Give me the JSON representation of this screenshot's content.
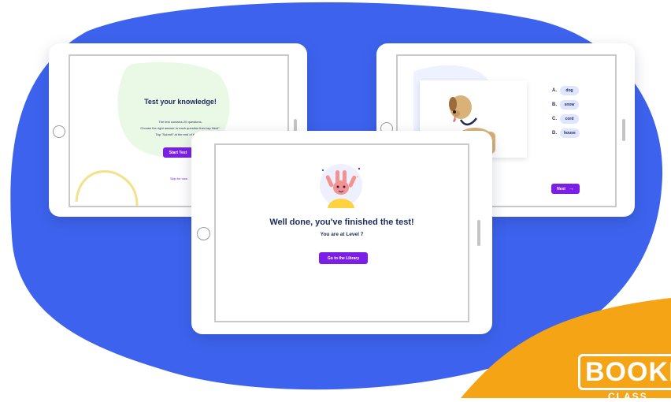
{
  "colors": {
    "blob": "#3d63ee",
    "accent_purple": "#7b1fe8",
    "logo_orange": "#f4a415",
    "title_navy": "#1d2a5c"
  },
  "left_tablet": {
    "title": "Test your knowledge!",
    "instructions": [
      "The test contains 20 questions.",
      "Choose the right answer to each question then tap Next\".",
      "Tap \"Submit\" at the end of the test.\""
    ],
    "start_button": "Start Test",
    "skip_link": "Skip for now"
  },
  "right_tablet": {
    "picture": "dog-illustration",
    "options": [
      {
        "letter": "A.",
        "text": "dog"
      },
      {
        "letter": "B.",
        "text": "snow"
      },
      {
        "letter": "C.",
        "text": "cord"
      },
      {
        "letter": "D.",
        "text": "house"
      }
    ],
    "next_button": "Next",
    "next_icon": "arrow-right-icon"
  },
  "center_tablet": {
    "illustration": "happy-bunny-illustration",
    "heading": "Well done, you've finished the test!",
    "level_text": "You are at Level 7",
    "library_button": "Go to the Library"
  },
  "logo": {
    "text": "BOOKR",
    "subtext": "CLASS"
  }
}
